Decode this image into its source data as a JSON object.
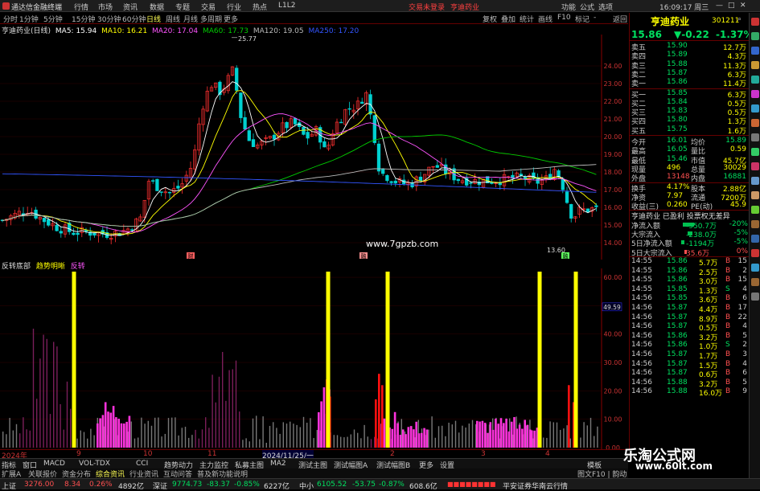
{
  "app_title": "通达信金融终端",
  "menu": [
    "行情",
    "市场",
    "资讯",
    "数据",
    "专题",
    "交易",
    "行业",
    "热点",
    "L1L2"
  ],
  "alerts": [
    "交易未登录",
    "亨迪药业"
  ],
  "top_controls": [
    "功能",
    "公式",
    "选项"
  ],
  "clock": "16:09:17 周三",
  "periods": [
    "分时",
    "1分钟",
    "5分钟",
    "15分钟",
    "30分钟",
    "60分钟",
    "日线",
    "周线",
    "月线",
    "多周期",
    "更多"
  ],
  "active_period": "日线",
  "tools": [
    "复权",
    "叠加",
    "统计",
    "画线",
    "F10",
    "标记",
    "-",
    "返回"
  ],
  "ma_line": {
    "name": "亨迪药业(日线)",
    "items": [
      {
        "label": "MA5: 15.94",
        "color": "#ffffff"
      },
      {
        "label": "MA10: 16.21",
        "color": "#ffff00"
      },
      {
        "label": "MA20: 17.04",
        "color": "#ff55ff"
      },
      {
        "label": "MA60: 17.73",
        "color": "#00cc00"
      },
      {
        "label": "MA120: 19.05",
        "color": "#bbbbbb"
      },
      {
        "label": "MA250: 17.20",
        "color": "#3355ff"
      }
    ]
  },
  "chart_data": [
    {
      "type": "candlestick",
      "ylim": [
        13.5,
        25.5
      ],
      "yticks": [
        14.0,
        15.0,
        16.0,
        17.0,
        18.0,
        19.0,
        20.0,
        21.0,
        22.0,
        23.0,
        24.0
      ],
      "annotations": {
        "high": "25.77",
        "low": "13.60"
      },
      "markers": [
        "财",
        "融",
        "融"
      ],
      "watermark": "www.7gpzb.com"
    },
    {
      "type": "bar",
      "title": "反转底部",
      "labels": [
        "趋势明晰",
        "反转"
      ],
      "ylim": [
        0,
        62
      ],
      "yticks": [
        0,
        10,
        20,
        30,
        40,
        50,
        60
      ],
      "ytick_labels": [
        "0.00",
        "10.00",
        "20.00",
        "30.00",
        "40.00",
        "50.00",
        "60.00"
      ],
      "current_value": "49.59"
    }
  ],
  "dates": [
    "2024年",
    "9",
    "10",
    "11",
    "2024/11/25/一",
    "2",
    "3",
    "4"
  ],
  "tabs": [
    "指标",
    "窗口",
    "MACD",
    "VOL-TDX",
    "CCI",
    "趋势动力",
    "主力监控",
    "私募主图",
    "MA2",
    "测试主图",
    "测试幅图A",
    "测试幅图B",
    "更多",
    "设置"
  ],
  "tabs2": [
    "扩展A",
    "关联报价",
    "资金分布",
    "综合资讯",
    "行业资讯",
    "互动问答",
    "普及新功能说明"
  ],
  "tabs_right": "模板",
  "tabs2_right": "图文F10 | 韵动",
  "status": [
    {
      "name": "上证",
      "value": "3276.00",
      "chg": "8.34",
      "pct": "0.26%",
      "amt": "4892亿"
    },
    {
      "name": "深证",
      "value": "9774.73",
      "chg": "-83.37",
      "pct": "-0.85%",
      "amt": "6227亿"
    },
    {
      "name": "中小",
      "value": "6105.52",
      "chg": "-53.75",
      "pct": "-0.87%",
      "amt": "608.6亿"
    }
  ],
  "broker": "平安证券华南云行情",
  "watermark_site": "乐淘公式网",
  "watermark_url": "www.60lt.com",
  "panel": {
    "name": "亨迪药业",
    "code": "301211",
    "price": "15.86",
    "change": "▼-0.22",
    "pct": "-1.37%",
    "asks": [
      {
        "label": "卖五",
        "price": "15.90",
        "vol": "12.7万"
      },
      {
        "label": "卖四",
        "price": "15.89",
        "vol": "4.3万"
      },
      {
        "label": "卖三",
        "price": "15.88",
        "vol": "11.3万"
      },
      {
        "label": "卖二",
        "price": "15.87",
        "vol": "6.3万"
      },
      {
        "label": "卖一",
        "price": "15.86",
        "vol": "11.4万"
      }
    ],
    "bids": [
      {
        "label": "买一",
        "price": "15.85",
        "vol": "6.3万"
      },
      {
        "label": "买二",
        "price": "15.84",
        "vol": "0.5万"
      },
      {
        "label": "买三",
        "price": "15.83",
        "vol": "0.5万"
      },
      {
        "label": "买四",
        "price": "15.80",
        "vol": "1.3万"
      },
      {
        "label": "买五",
        "price": "15.75",
        "vol": "1.6万"
      }
    ],
    "stats": [
      [
        "今开",
        "16.01",
        "均价",
        "15.89"
      ],
      [
        "最高",
        "16.05",
        "量比",
        "0.59"
      ],
      [
        "最低",
        "15.46",
        "市值",
        "45.7亿"
      ],
      [
        "现量",
        "496",
        "总量",
        "30029"
      ],
      [
        "外盘",
        "13148",
        "内盘",
        "16881"
      ],
      [
        "换手",
        "4.17%",
        "股本",
        "2.88亿"
      ],
      [
        "净资",
        "7.97",
        "流通",
        "7200万"
      ],
      [
        "收益(三)",
        "0.260",
        "PE(动)",
        "45.9"
      ]
    ],
    "flow_title": "亨迪药业 已盈利 投票权无差异",
    "flows": [
      [
        "净流入额",
        "-950.7万",
        "-20%"
      ],
      [
        "大宗流入",
        "-238.0万",
        "-5%"
      ],
      [
        "5日净流入额",
        "-1194万",
        "-5%"
      ],
      [
        "5日大宗流入",
        "35.6万",
        "0%"
      ]
    ],
    "ticks": [
      [
        "14:55",
        "15.86",
        "5.7万",
        "B",
        "15"
      ],
      [
        "14:55",
        "15.86",
        "2.5万",
        "B",
        "2"
      ],
      [
        "14:55",
        "15.86",
        "3.0万",
        "B",
        "15"
      ],
      [
        "14:55",
        "15.85",
        "1.3万",
        "S",
        "4"
      ],
      [
        "14:56",
        "15.85",
        "3.6万",
        "B",
        "6"
      ],
      [
        "14:56",
        "15.87",
        "4.4万",
        "B",
        "17"
      ],
      [
        "14:56",
        "15.87",
        "8.9万",
        "B",
        "22"
      ],
      [
        "14:56",
        "15.87",
        "0.5万",
        "B",
        "4"
      ],
      [
        "14:56",
        "15.86",
        "3.2万",
        "B",
        "5"
      ],
      [
        "14:56",
        "15.86",
        "1.0万",
        "S",
        "2"
      ],
      [
        "14:56",
        "15.87",
        "1.7万",
        "B",
        "3"
      ],
      [
        "14:56",
        "15.87",
        "1.5万",
        "B",
        "4"
      ],
      [
        "14:56",
        "15.87",
        "0.6万",
        "B",
        "6"
      ],
      [
        "14:56",
        "15.88",
        "3.2万",
        "B",
        "5"
      ],
      [
        "14:56",
        "15.88",
        "16.0万",
        "B",
        "9"
      ]
    ]
  }
}
